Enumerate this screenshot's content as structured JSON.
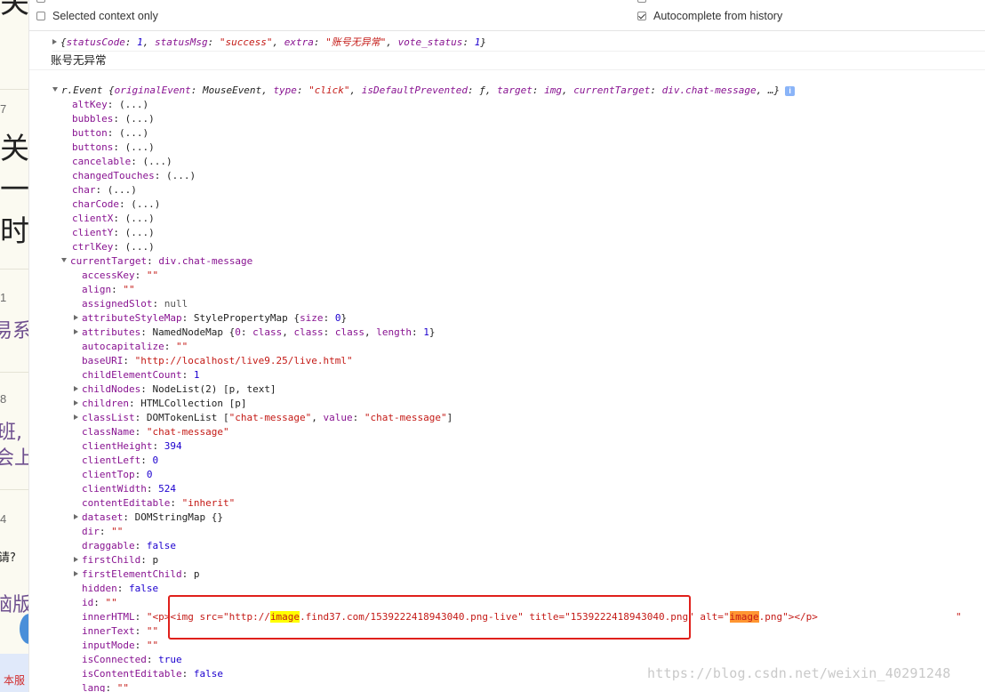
{
  "left_panel": {
    "items": [
      {
        "text": "关",
        "style": "big"
      },
      {
        "text": "7",
        "style": "num"
      },
      {
        "text": "关",
        "style": "big"
      },
      {
        "text": "一",
        "style": "big"
      },
      {
        "text": "时",
        "style": "big"
      },
      {
        "text": "1",
        "style": "num"
      },
      {
        "text": "易系",
        "style": "purple"
      },
      {
        "text": "8",
        "style": "num"
      },
      {
        "text": "班,",
        "style": "purple"
      },
      {
        "text": "会上",
        "style": "purple"
      },
      {
        "text": "4",
        "style": "num"
      },
      {
        "text": "请?",
        "style": "dark"
      },
      {
        "text": "脑版",
        "style": "purple"
      },
      {
        "text": "本服",
        "style": "red"
      }
    ]
  },
  "settings": {
    "selected_context_only": {
      "label": "Selected context only",
      "checked": false
    },
    "autocomplete_from_history": {
      "label": "Autocomplete from history",
      "checked": true
    }
  },
  "console": {
    "response_object": {
      "open": "{",
      "k1": "statusCode",
      "v1": "1",
      "k2": "statusMsg",
      "v2": "\"success\"",
      "k3": "extra",
      "v3": "\"账号无异常\"",
      "k4": "vote_status",
      "v4": "1",
      "close": "}"
    },
    "log_text": "账号无异常",
    "event_header": {
      "name": "r.Event",
      "open": " {",
      "k1": "originalEvent",
      "v1": "MouseEvent",
      "k2": "type",
      "v2": "\"click\"",
      "k3": "isDefaultPrevented",
      "v3": "ƒ",
      "k4": "target",
      "v4": "img",
      "k5": "currentTarget",
      "v5": "div.chat-message",
      "close": ", …}",
      "info": "i"
    },
    "lazy_props": [
      {
        "key": "altKey",
        "value": "(...)"
      },
      {
        "key": "bubbles",
        "value": "(...)"
      },
      {
        "key": "button",
        "value": "(...)"
      },
      {
        "key": "buttons",
        "value": "(...)"
      },
      {
        "key": "cancelable",
        "value": "(...)"
      },
      {
        "key": "changedTouches",
        "value": "(...)"
      },
      {
        "key": "char",
        "value": "(...)"
      },
      {
        "key": "charCode",
        "value": "(...)"
      },
      {
        "key": "clientX",
        "value": "(...)"
      },
      {
        "key": "clientY",
        "value": "(...)"
      },
      {
        "key": "ctrlKey",
        "value": "(...)"
      }
    ],
    "current_target": {
      "key": "currentTarget",
      "value": "div.chat-message"
    },
    "ct_props": [
      {
        "key": "accessKey",
        "value": "\"\"",
        "kind": "str",
        "expandable": false
      },
      {
        "key": "align",
        "value": "\"\"",
        "kind": "str",
        "expandable": false
      },
      {
        "key": "assignedSlot",
        "value": "null",
        "kind": "null",
        "expandable": false
      },
      {
        "key": "attributeStyleMap",
        "value": "StylePropertyMap {size: 0}",
        "kind": "attrmap",
        "expandable": true
      },
      {
        "key": "attributes",
        "value": "NamedNodeMap {0: class, class: class, length: 1}",
        "kind": "nodemap",
        "expandable": true
      },
      {
        "key": "autocapitalize",
        "value": "\"\"",
        "kind": "str",
        "expandable": false
      },
      {
        "key": "baseURI",
        "value": "\"http://localhost/live9.25/live.html\"",
        "kind": "str",
        "expandable": false
      },
      {
        "key": "childElementCount",
        "value": "1",
        "kind": "num",
        "expandable": false
      },
      {
        "key": "childNodes",
        "value": "NodeList(2) [p, text]",
        "kind": "obj",
        "expandable": true
      },
      {
        "key": "children",
        "value": "HTMLCollection [p]",
        "kind": "obj",
        "expandable": true
      },
      {
        "key": "classList",
        "value": "DOMTokenList [\"chat-message\", value: \"chat-message\"]",
        "kind": "tokenlist",
        "expandable": true
      },
      {
        "key": "className",
        "value": "\"chat-message\"",
        "kind": "str",
        "expandable": false
      },
      {
        "key": "clientHeight",
        "value": "394",
        "kind": "num",
        "expandable": false
      },
      {
        "key": "clientLeft",
        "value": "0",
        "kind": "num",
        "expandable": false
      },
      {
        "key": "clientTop",
        "value": "0",
        "kind": "num",
        "expandable": false
      },
      {
        "key": "clientWidth",
        "value": "524",
        "kind": "num",
        "expandable": false
      },
      {
        "key": "contentEditable",
        "value": "\"inherit\"",
        "kind": "str",
        "expandable": false
      },
      {
        "key": "dataset",
        "value": "DOMStringMap {}",
        "kind": "obj",
        "expandable": true
      },
      {
        "key": "dir",
        "value": "\"\"",
        "kind": "str",
        "expandable": false
      },
      {
        "key": "draggable",
        "value": "false",
        "kind": "num",
        "expandable": false
      },
      {
        "key": "firstChild",
        "value": "p",
        "kind": "obj",
        "expandable": true
      },
      {
        "key": "firstElementChild",
        "value": "p",
        "kind": "obj",
        "expandable": true
      },
      {
        "key": "hidden",
        "value": "false",
        "kind": "num",
        "expandable": false
      },
      {
        "key": "id",
        "value": "\"\"",
        "kind": "str",
        "expandable": false
      }
    ],
    "inner_html": {
      "key": "innerHTML",
      "p1": "\"<p><img src=\"http://",
      "h1": "image",
      "p2": ".find37.com/1539222418943040.png-live\" title=\"1539222418943040.png\" alt=\"",
      "h2": "image",
      "p3": ".png\"></p>",
      "tail": "\""
    },
    "after_props": [
      {
        "key": "innerText",
        "value": "\"\"",
        "kind": "str"
      },
      {
        "key": "inputMode",
        "value": "\"\"",
        "kind": "str"
      },
      {
        "key": "isConnected",
        "value": "true",
        "kind": "num"
      },
      {
        "key": "isContentEditable",
        "value": "false",
        "kind": "num"
      },
      {
        "key": "lang",
        "value": "\"\"",
        "kind": "str"
      }
    ]
  },
  "watermark": "https://blog.csdn.net/weixin_40291248",
  "colors": {
    "key": "#881391",
    "string": "#c41a16",
    "number": "#1c00cf",
    "highlight_yellow": "#ffff00",
    "highlight_orange": "#ff9632",
    "annotation_box": "#e0201b"
  }
}
